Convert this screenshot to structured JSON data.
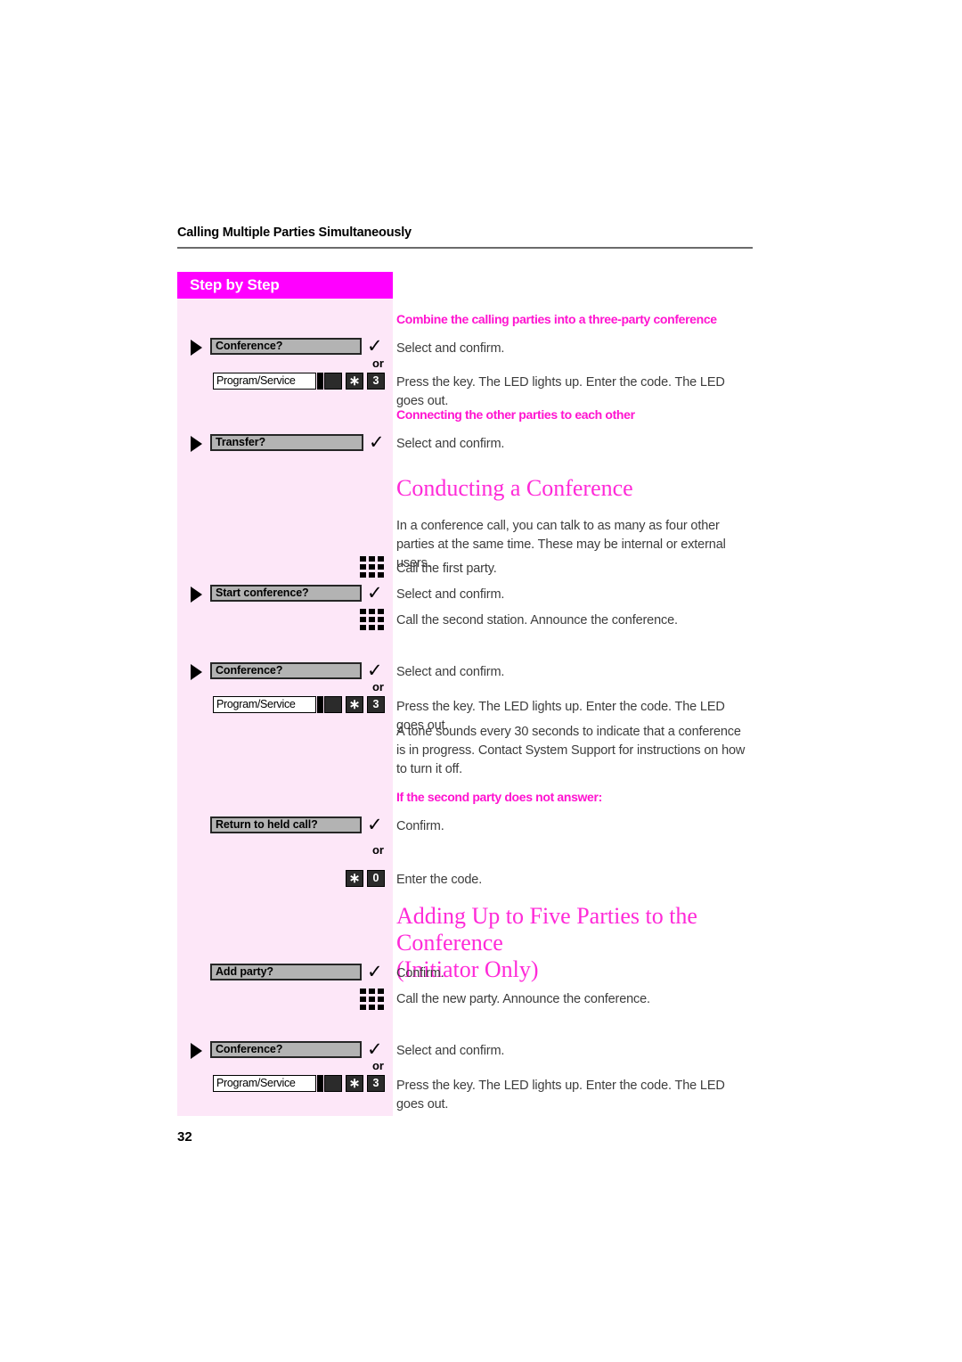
{
  "document": {
    "running_head": "Calling Multiple Parties Simultaneously",
    "page_number": "32",
    "sidebar_title": "Step by Step"
  },
  "colors": {
    "accent_magenta": "#ff00ff",
    "sidebar_bg": "#fde7f8",
    "heading_pink": "#ff2ad8",
    "subhead_pink": "#ff14d0",
    "menu_grey": "#b3b3b3",
    "body_text": "#3d3d3d"
  },
  "labels": {
    "or": "or",
    "conference": "Conference?",
    "transfer": "Transfer?",
    "start_conference": "Start conference?",
    "return_to_held_call": "Return to held call?",
    "add_party": "Add party?",
    "program_service": "Program/Service",
    "key_star": "∗",
    "key_three": "3",
    "key_zero": "0",
    "checkmark": "✓"
  },
  "sections": [
    {
      "id": "combine-three-party",
      "subhead": "Combine the calling parties into a three-party conference",
      "steps": [
        {
          "instruction": "Select and confirm."
        },
        {
          "instruction": "Press the key. The LED lights up. Enter the code. The LED goes out."
        }
      ]
    },
    {
      "id": "connecting-other-parties",
      "subhead": "Connecting the other parties to each other",
      "steps": [
        {
          "instruction": "Select and confirm."
        }
      ]
    },
    {
      "id": "conducting-a-conference",
      "title": "Conducting a Conference",
      "intro": "In a conference call, you can talk to as many as four other parties at the same time. These may be internal or external users.",
      "steps": [
        {
          "instruction": "Call the first party."
        },
        {
          "instruction": "Select and confirm."
        },
        {
          "instruction": "Call the second station. Announce the conference."
        },
        {
          "instruction": "Select and confirm."
        },
        {
          "instruction": "Press the key. The LED lights up. Enter the code. The LED goes out."
        }
      ],
      "note": "A tone sounds every 30 seconds to indicate that a conference is in progress. Contact System Support for instructions on how to turn it off."
    },
    {
      "id": "second-party-no-answer",
      "subhead": "If the second party does not answer:",
      "steps": [
        {
          "instruction": "Confirm."
        },
        {
          "instruction": "Enter the code."
        }
      ]
    },
    {
      "id": "adding-five-parties",
      "title": "Adding Up to Five Parties to the Conference (Initiator Only)",
      "title_line1": "Adding Up to Five Parties to the Conference",
      "title_line2": "(Initiator Only)",
      "steps": [
        {
          "instruction": "Confirm."
        },
        {
          "instruction": "Call the new party. Announce the conference."
        },
        {
          "instruction": "Select and confirm."
        },
        {
          "instruction": "Press the key. The LED lights up. Enter the code. The LED goes out."
        }
      ]
    }
  ]
}
